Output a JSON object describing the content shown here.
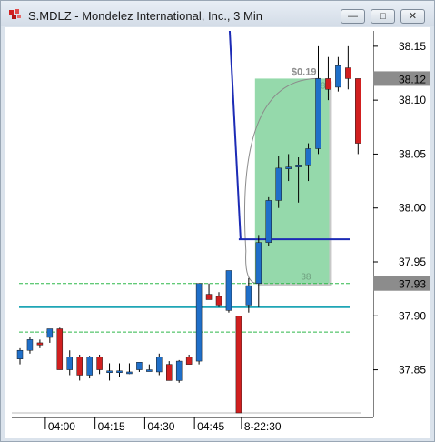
{
  "window": {
    "title": "S.MDLZ - Mondelez International, Inc., 3 Min",
    "minimize_glyph": "—",
    "maximize_glyph": "□",
    "close_glyph": "✕"
  },
  "chart_data": {
    "type": "candlestick",
    "ylim": [
      37.81,
      38.16
    ],
    "y_ticks": [
      "38.15",
      "38.10",
      "38.05",
      "38.00",
      "37.95",
      "37.90",
      "37.85"
    ],
    "x_ticks": [
      "04:00",
      "04:15",
      "04:30",
      "04:45",
      "8-22:30"
    ],
    "price_markers": [
      {
        "label": "38.12",
        "value": 38.12
      },
      {
        "label": "37.93",
        "value": 37.93
      }
    ],
    "horizontal_lines": [
      {
        "value": 37.93,
        "style": "dashed",
        "color": "#2fb84a"
      },
      {
        "value": 37.885,
        "style": "dashed",
        "color": "#2fb84a"
      },
      {
        "value": 37.908,
        "style": "solid",
        "color": "#1fa5b5"
      },
      {
        "value": 37.971,
        "style": "solid",
        "color": "#1c2bb5"
      }
    ],
    "rectangle": {
      "top_value": 38.12,
      "bottom_value": 37.93,
      "top_label": "38",
      "bottom_label": "38",
      "measure_label": "$0.19"
    },
    "candles": [
      {
        "o": 37.86,
        "h": 37.87,
        "l": 37.855,
        "c": 37.868
      },
      {
        "o": 37.868,
        "h": 37.88,
        "l": 37.865,
        "c": 37.878
      },
      {
        "o": 37.875,
        "h": 37.878,
        "l": 37.87,
        "c": 37.873
      },
      {
        "o": 37.88,
        "h": 37.885,
        "l": 37.875,
        "c": 37.888
      },
      {
        "o": 37.888,
        "h": 37.889,
        "l": 37.85,
        "c": 37.85
      },
      {
        "o": 37.85,
        "h": 37.868,
        "l": 37.845,
        "c": 37.862
      },
      {
        "o": 37.862,
        "h": 37.864,
        "l": 37.84,
        "c": 37.845
      },
      {
        "o": 37.845,
        "h": 37.863,
        "l": 37.842,
        "c": 37.862
      },
      {
        "o": 37.862,
        "h": 37.864,
        "l": 37.846,
        "c": 37.85
      },
      {
        "o": 37.849,
        "h": 37.856,
        "l": 37.84,
        "c": 37.849
      },
      {
        "o": 37.849,
        "h": 37.856,
        "l": 37.843,
        "c": 37.849
      },
      {
        "o": 37.848,
        "h": 37.856,
        "l": 37.846,
        "c": 37.848
      },
      {
        "o": 37.85,
        "h": 37.857,
        "l": 37.848,
        "c": 37.857
      },
      {
        "o": 37.85,
        "h": 37.855,
        "l": 37.849,
        "c": 37.85
      },
      {
        "o": 37.848,
        "h": 37.865,
        "l": 37.845,
        "c": 37.862
      },
      {
        "o": 37.855,
        "h": 37.858,
        "l": 37.84,
        "c": 37.84
      },
      {
        "o": 37.84,
        "h": 37.859,
        "l": 37.838,
        "c": 37.858
      },
      {
        "o": 37.862,
        "h": 37.864,
        "l": 37.855,
        "c": 37.855
      },
      {
        "o": 37.858,
        "h": 37.93,
        "l": 37.855,
        "c": 37.93
      },
      {
        "o": 37.92,
        "h": 37.93,
        "l": 37.915,
        "c": 37.915
      },
      {
        "o": 37.918,
        "h": 37.922,
        "l": 37.908,
        "c": 37.91
      },
      {
        "o": 37.905,
        "h": 37.942,
        "l": 37.903,
        "c": 37.942
      },
      {
        "o": 37.9,
        "h": 37.9,
        "l": 37.81,
        "c": 37.81
      },
      {
        "o": 37.91,
        "h": 37.935,
        "l": 37.903,
        "c": 37.928
      },
      {
        "o": 37.93,
        "h": 37.975,
        "l": 37.908,
        "c": 37.968
      },
      {
        "o": 37.968,
        "h": 38.01,
        "l": 37.965,
        "c": 38.007
      },
      {
        "o": 38.007,
        "h": 38.048,
        "l": 38.0,
        "c": 38.037
      },
      {
        "o": 38.037,
        "h": 38.05,
        "l": 38.025,
        "c": 38.038
      },
      {
        "o": 38.038,
        "h": 38.047,
        "l": 38.005,
        "c": 38.04
      },
      {
        "o": 38.04,
        "h": 38.06,
        "l": 38.025,
        "c": 38.055
      },
      {
        "o": 38.055,
        "h": 38.15,
        "l": 38.05,
        "c": 38.12
      },
      {
        "o": 38.12,
        "h": 38.14,
        "l": 38.1,
        "c": 38.11
      },
      {
        "o": 38.112,
        "h": 38.14,
        "l": 38.108,
        "c": 38.132
      },
      {
        "o": 38.13,
        "h": 38.15,
        "l": 38.11,
        "c": 38.12
      },
      {
        "o": 38.12,
        "h": 38.12,
        "l": 38.05,
        "c": 38.06
      }
    ],
    "colors": {
      "up": "#1f6fc9",
      "down": "#d11f1f",
      "box_fill": "#95d9ab",
      "blue_line": "#1c2bb5"
    }
  }
}
